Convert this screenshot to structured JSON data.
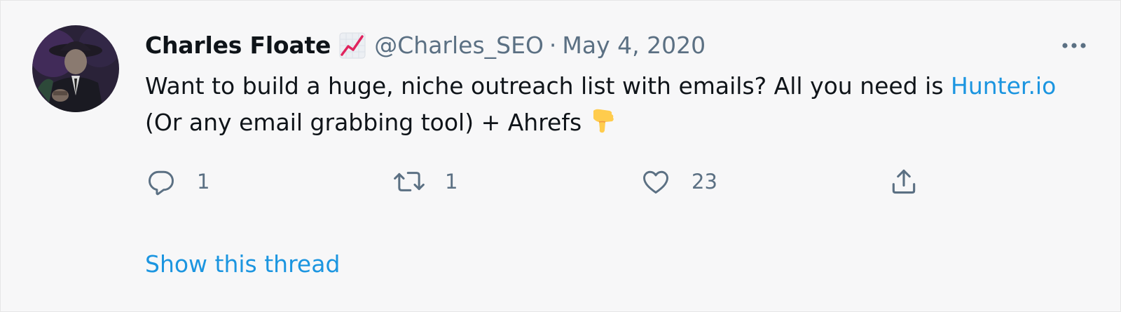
{
  "tweet": {
    "author_name": "Charles Floate",
    "author_handle": "@Charles_SEO",
    "separator": "·",
    "date": "May 4, 2020",
    "text_part1": "Want to build a huge, niche outreach list with emails? All you need is ",
    "link_text": "Hunter.io",
    "text_part2": " (Or any email grabbing tool) + Ahrefs",
    "icons": {
      "badge": "chart-increasing-emoji-icon",
      "more": "more-options-icon",
      "hand": "backhand-index-pointing-down-emoji-icon"
    }
  },
  "actions": {
    "reply_count": "1",
    "retweet_count": "1",
    "like_count": "23",
    "icons": [
      "reply-icon",
      "retweet-icon",
      "like-icon",
      "share-icon"
    ]
  },
  "show_thread_label": "Show this thread",
  "colors": {
    "link": "#1b95e0",
    "secondary_text": "#5b7083",
    "primary_text": "#0f1419",
    "background": "#f7f7f8"
  }
}
